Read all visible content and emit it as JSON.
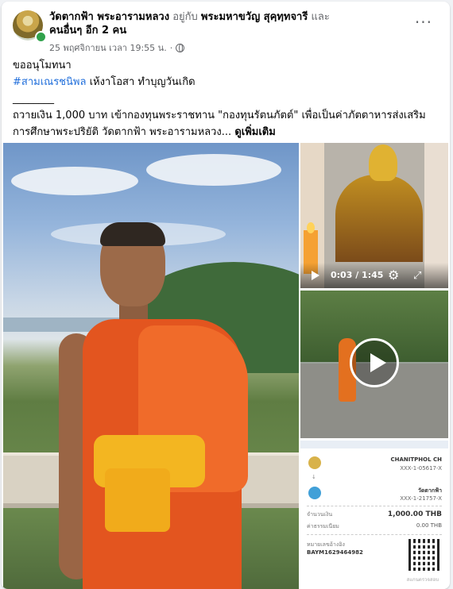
{
  "header": {
    "page_name": "วัดตากฟ้า พระอารามหลวง",
    "with_text": "อยู่กับ",
    "tagged_person": "พระมหาขวัญ สุคฺทฺทจารี",
    "and_text": "และ",
    "others": "คนอื่นๆ อีก 2 คน",
    "timestamp": "25 พฤศจิกายน เวลา 19:55 น.",
    "separator": "·",
    "more_label": "···"
  },
  "post": {
    "line1": "ขออนุโมทนา",
    "hashtag": "#สามเณรชนิพล",
    "line2_rest": " เห้งาโอสา ทำบุญวันเกิด",
    "divider": "________",
    "body": "ถวายเงิน 1,000 บาท เข้ากองทุนพระราชทาน \"กองทุนรัตนภัตต์\" เพื่อเป็นค่าภัตตาหารส่งเสริมการศึกษาพระปริยัติ วัดตากฟ้า พระอารามหลวง...",
    "see_more": "ดูเพิ่มเติม"
  },
  "video": {
    "time": "0:03 / 1:45",
    "settings_icon": "gear-icon",
    "fullscreen_icon": "expand-icon"
  },
  "receipt": {
    "sender_name": "CHANITPHOL CH",
    "sender_account": "XXX-1-05617-X",
    "arrow": "↓",
    "receiver_name": "วัดตากฟ้า",
    "receiver_account": "XXX-1-21757-X",
    "amount_label": "จำนวนเงิน",
    "amount": "1,000.00 THB",
    "fee_label": "ค่าธรรมเนียม",
    "fee": "0.00 THB",
    "ref_label": "หมายเลขอ้างอิง",
    "ref": "BAYM1629464982",
    "watermark": "สแกนตรวจสอบ"
  }
}
